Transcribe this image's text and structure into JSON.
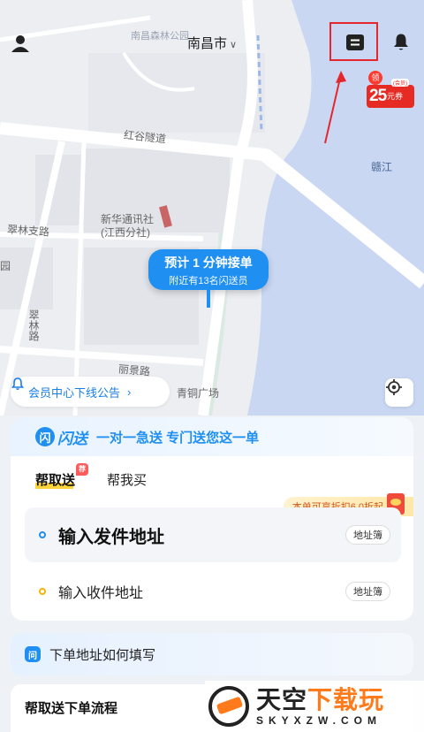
{
  "header": {
    "city": "南昌市",
    "user_icon": "user-icon",
    "orders_icon": "list-icon",
    "notification_icon": "bell-icon"
  },
  "coupon": {
    "prefix": "领",
    "amount": "25",
    "unit": "元券",
    "tag": "(会员)"
  },
  "map": {
    "labels": {
      "park": "南昌森林公园",
      "tunnel": "红谷隧道",
      "river": "赣江",
      "building1": "新华通讯社",
      "building2": "(江西分社)",
      "road1": "翠林支路",
      "road2": "翠林路",
      "road3": "丽景路",
      "park2": "园",
      "plaza": "青铜广场"
    },
    "bubble_title": "预计 1 分钟接单",
    "bubble_sub": "附近有13名闪送员"
  },
  "notice": {
    "text": "会员中心下线公告",
    "arrow": "›"
  },
  "card": {
    "brand_mark": "闪",
    "brand_name": "闪送",
    "slogan": "一对一急送  专门送您这一单",
    "tabs": {
      "active": "帮取送",
      "badge": "荐",
      "other": "帮我买"
    },
    "promo": "本单可享折扣6.0折起",
    "sender_placeholder": "输入发件地址",
    "receiver_placeholder": "输入收件地址",
    "address_book": "地址簿"
  },
  "help": {
    "icon": "问",
    "text": "下单地址如何填写"
  },
  "flow": {
    "title": "帮取送下单流程"
  },
  "watermark": {
    "big_a": "天空",
    "big_b": "下载玩",
    "small": "SKYXZW.COM"
  }
}
